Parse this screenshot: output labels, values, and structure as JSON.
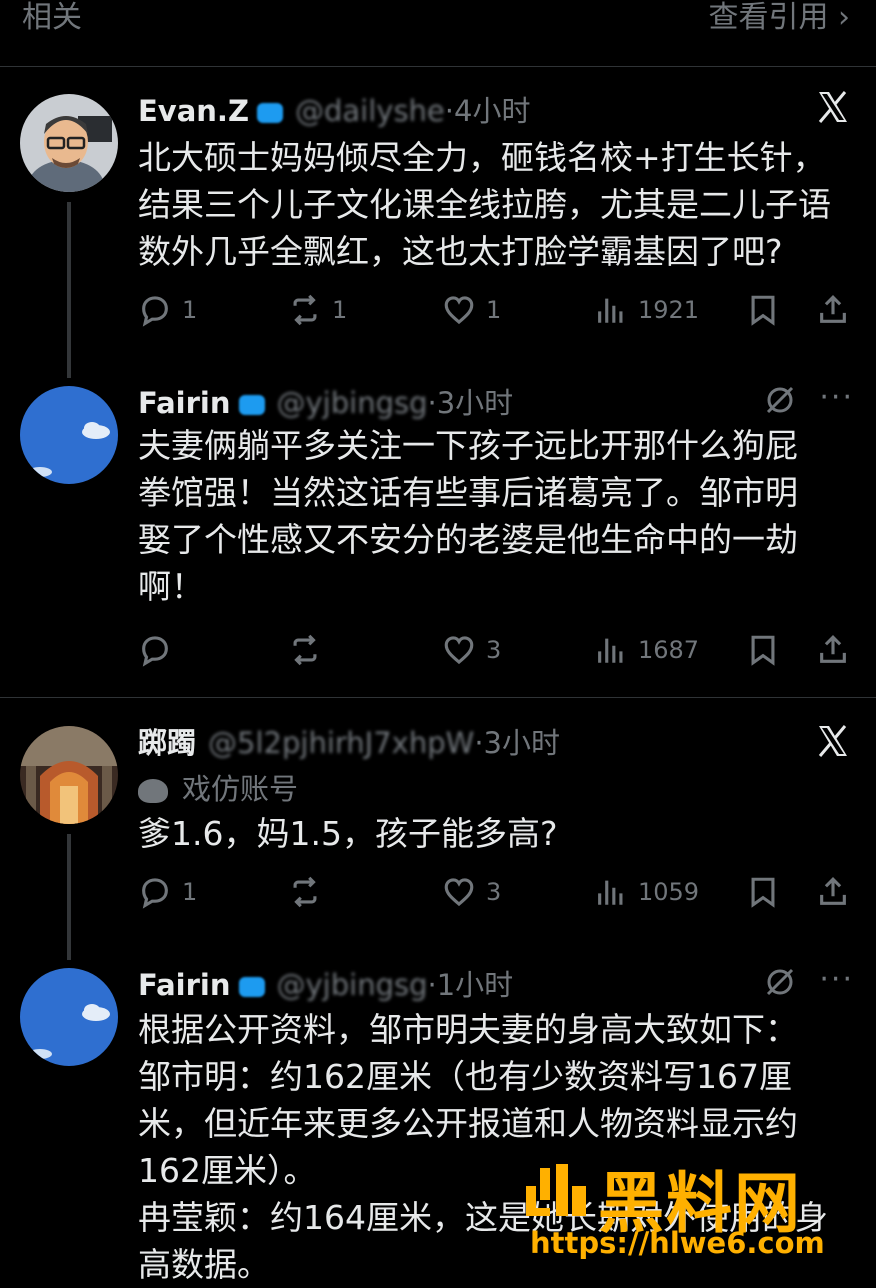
{
  "topbar": {
    "left_label": "相关",
    "right_label": "查看引用"
  },
  "posts": [
    {
      "author": "Evan.Z",
      "handle": "@dailyshe",
      "time": "·4小时",
      "lines": [
        "北大硕士妈妈倾尽全力，砸钱名校+打生长针，",
        "结果三个儿子文化课全线拉胯，尤其是二儿子语",
        "数外几乎全飘红，这也太打脸学霸基因了吧?"
      ],
      "replies": "1",
      "reposts": "1",
      "likes": "1",
      "views": "1921"
    },
    {
      "author": "Fairin",
      "handle": "@yjbingsg",
      "time": "·3小时",
      "lines": [
        "夫妻俩躺平多关注一下孩子远比开那什么狗屁",
        "拳馆强！当然这话有些事后诸葛亮了。邹市明",
        "娶了个性感又不安分的老婆是他生命中的一劫",
        "啊！"
      ],
      "replies": "",
      "reposts": "",
      "likes": "3",
      "views": "1687"
    },
    {
      "author": "踯躅",
      "handle": "@5l2pjhirhJ7xhpW",
      "time": "·3小时",
      "parody_label": "戏仿账号",
      "lines": [
        "爹1.6，妈1.5，孩子能多高?"
      ],
      "replies": "1",
      "reposts": "",
      "likes": "3",
      "views": "1059"
    },
    {
      "author": "Fairin",
      "handle": "@yjbingsg",
      "time": "·1小时",
      "lines": [
        "根据公开资料，邹市明夫妻的身高大致如下：",
        "邹市明：约162厘米（也有少数资料写167厘",
        "米，但近年来更多公开报道和人物资料显示约",
        "162厘米）。",
        "冉莹颖：约164厘米，这是她长期对外使用的身",
        "高数据。"
      ]
    }
  ],
  "watermark": {
    "title": "黑料网",
    "url": "https://hlwe6.com"
  },
  "colors": {
    "background": "#000000",
    "text": "#e7e9ea",
    "muted": "#71767b",
    "divider": "#2f3336",
    "watermark": "#ffb000"
  }
}
